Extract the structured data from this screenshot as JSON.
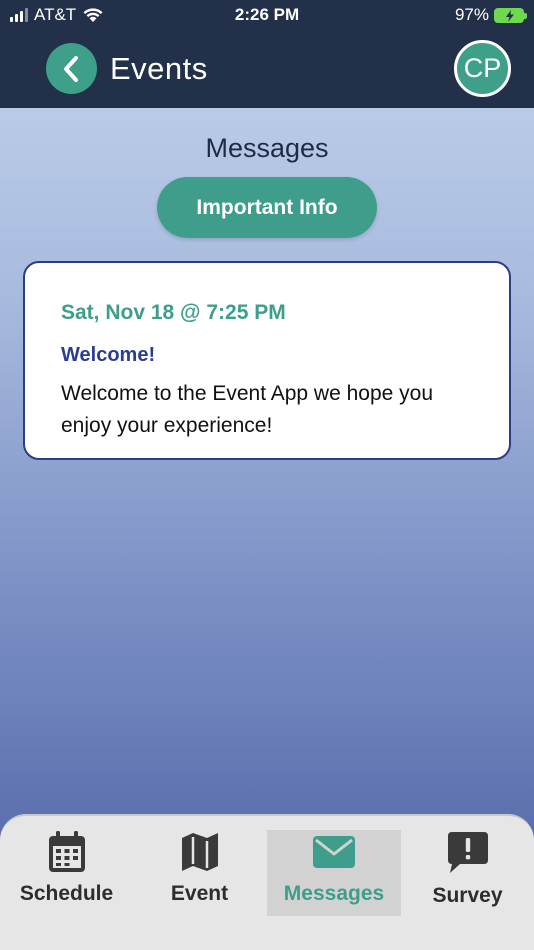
{
  "status_bar": {
    "carrier": "AT&T",
    "time": "2:26 PM",
    "battery": "97%"
  },
  "header": {
    "title": "Events",
    "avatar_initials": "CP"
  },
  "main": {
    "section_title": "Messages",
    "filter_button": "Important Info",
    "messages": [
      {
        "date": "Sat, Nov 18 @ 7:25 PM",
        "title": "Welcome!",
        "body": "Welcome to the Event App we hope you enjoy your experience!"
      }
    ]
  },
  "tab_bar": {
    "tabs": [
      {
        "label": "Schedule",
        "icon": "calendar-icon"
      },
      {
        "label": "Event",
        "icon": "map-icon"
      },
      {
        "label": "Messages",
        "icon": "envelope-icon",
        "active": true
      },
      {
        "label": "Survey",
        "icon": "alert-bubble-icon"
      }
    ]
  },
  "colors": {
    "header_bg": "#23304a",
    "accent": "#3f9e8b",
    "message_title": "#2b3d8f"
  }
}
